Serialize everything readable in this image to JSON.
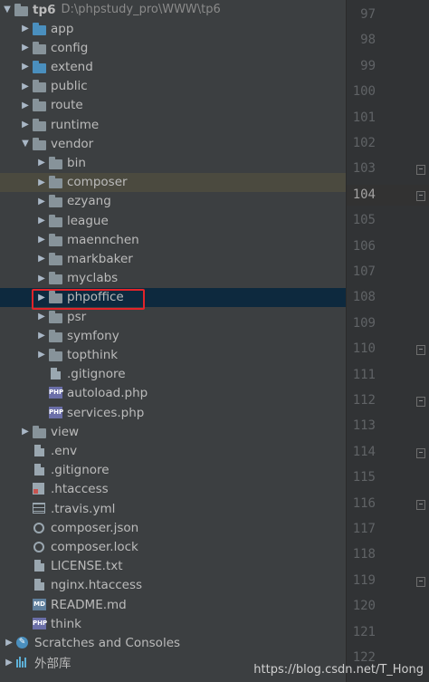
{
  "project": {
    "name": "tp6",
    "path": "D:\\phpstudy_pro\\WWW\\tp6"
  },
  "tree": [
    {
      "label": "app",
      "indent": 1,
      "expanded": false,
      "icon": "folder-blue"
    },
    {
      "label": "config",
      "indent": 1,
      "expanded": false,
      "icon": "folder"
    },
    {
      "label": "extend",
      "indent": 1,
      "expanded": false,
      "icon": "folder-blue"
    },
    {
      "label": "public",
      "indent": 1,
      "expanded": false,
      "icon": "folder"
    },
    {
      "label": "route",
      "indent": 1,
      "expanded": false,
      "icon": "folder"
    },
    {
      "label": "runtime",
      "indent": 1,
      "expanded": false,
      "icon": "folder"
    },
    {
      "label": "vendor",
      "indent": 1,
      "expanded": true,
      "icon": "folder"
    },
    {
      "label": "bin",
      "indent": 2,
      "expanded": false,
      "icon": "folder"
    },
    {
      "label": "composer",
      "indent": 2,
      "expanded": false,
      "icon": "folder",
      "state": "soft-selected"
    },
    {
      "label": "ezyang",
      "indent": 2,
      "expanded": false,
      "icon": "folder"
    },
    {
      "label": "league",
      "indent": 2,
      "expanded": false,
      "icon": "folder"
    },
    {
      "label": "maennchen",
      "indent": 2,
      "expanded": false,
      "icon": "folder"
    },
    {
      "label": "markbaker",
      "indent": 2,
      "expanded": false,
      "icon": "folder"
    },
    {
      "label": "myclabs",
      "indent": 2,
      "expanded": false,
      "icon": "folder"
    },
    {
      "label": "phpoffice",
      "indent": 2,
      "expanded": false,
      "icon": "folder",
      "state": "selected"
    },
    {
      "label": "psr",
      "indent": 2,
      "expanded": false,
      "icon": "folder"
    },
    {
      "label": "symfony",
      "indent": 2,
      "expanded": false,
      "icon": "folder"
    },
    {
      "label": "topthink",
      "indent": 2,
      "expanded": false,
      "icon": "folder"
    },
    {
      "label": ".gitignore",
      "indent": 2,
      "icon": "file"
    },
    {
      "label": "autoload.php",
      "indent": 2,
      "icon": "php-file"
    },
    {
      "label": "services.php",
      "indent": 2,
      "icon": "php-file"
    },
    {
      "label": "view",
      "indent": 1,
      "expanded": false,
      "icon": "folder"
    },
    {
      "label": ".env",
      "indent": 1,
      "icon": "file"
    },
    {
      "label": ".gitignore",
      "indent": 1,
      "icon": "file"
    },
    {
      "label": ".htaccess",
      "indent": 1,
      "icon": "htaccess-file"
    },
    {
      "label": ".travis.yml",
      "indent": 1,
      "icon": "yml-file"
    },
    {
      "label": "composer.json",
      "indent": 1,
      "icon": "config-file"
    },
    {
      "label": "composer.lock",
      "indent": 1,
      "icon": "config-file"
    },
    {
      "label": "LICENSE.txt",
      "indent": 1,
      "icon": "file"
    },
    {
      "label": "nginx.htaccess",
      "indent": 1,
      "icon": "file"
    },
    {
      "label": "README.md",
      "indent": 1,
      "icon": "md-file"
    },
    {
      "label": "think",
      "indent": 1,
      "icon": "php-file"
    },
    {
      "label": "Scratches and Consoles",
      "indent": 0,
      "expanded": false,
      "icon": "scratches"
    },
    {
      "label": "外部库",
      "indent": 0,
      "expanded": false,
      "icon": "libraries"
    }
  ],
  "gutter": {
    "lines": [
      "97",
      "98",
      "99",
      "100",
      "101",
      "102",
      "103",
      "104",
      "105",
      "106",
      "107",
      "108",
      "109",
      "110",
      "111",
      "112",
      "113",
      "114",
      "115",
      "116",
      "117",
      "118",
      "119",
      "120",
      "121",
      "122"
    ],
    "current_line": "104"
  },
  "watermark": "https://blog.csdn.net/T_Hong",
  "colors": {
    "background": "#3c3f41",
    "selection": "#0d293e",
    "highlight_box": "#e0242a",
    "folder_blue": "#4a8fbe"
  }
}
